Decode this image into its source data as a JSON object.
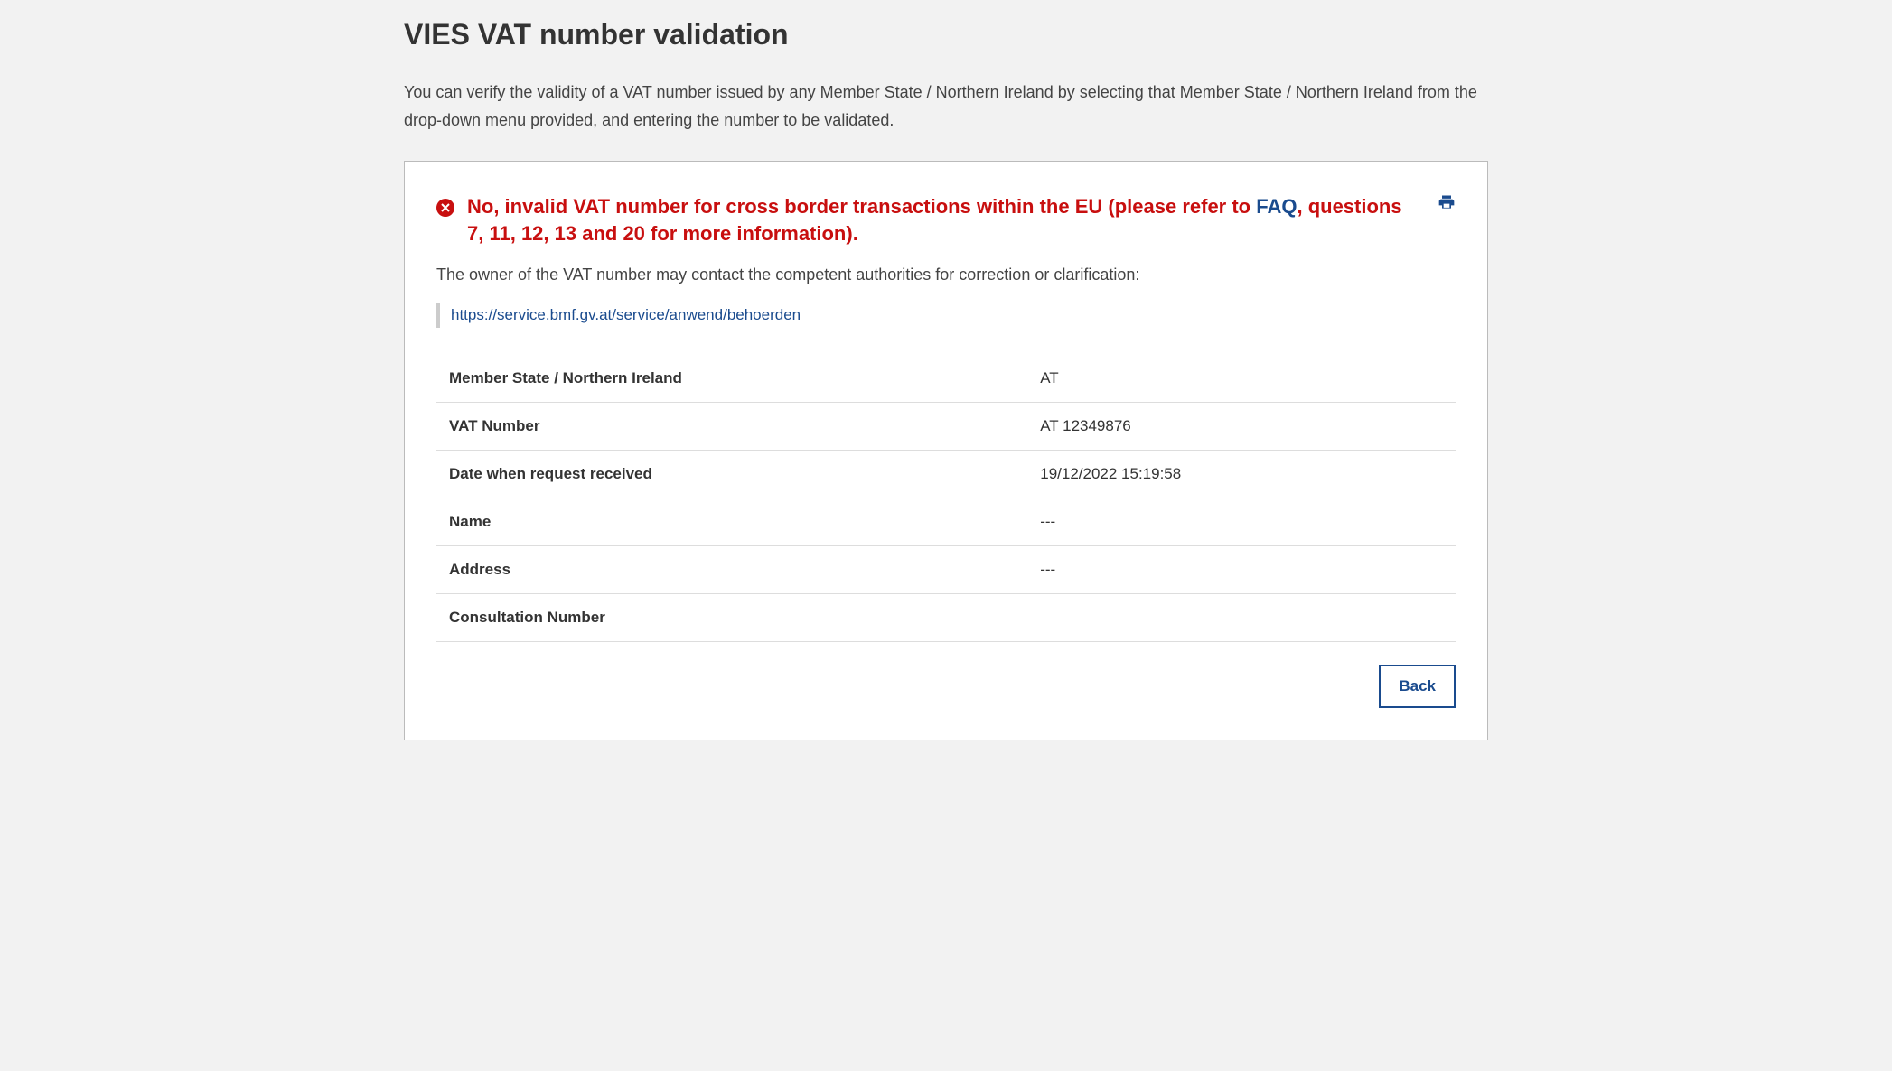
{
  "page": {
    "title": "VIES VAT number validation",
    "intro": "You can verify the validity of a VAT number issued by any Member State / Northern Ireland by selecting that Member State / Northern Ireland from the drop-down menu provided, and entering the number to be validated."
  },
  "alert": {
    "prefix": "No, invalid VAT number for cross border transactions within the EU (please refer to ",
    "faq_text": "FAQ",
    "suffix": ", questions 7, 11, 12, 13 and 20 for more information)."
  },
  "sub_message": "The owner of the VAT number may contact the competent authorities for correction or clarification:",
  "authority_link": "https://service.bmf.gv.at/service/anwend/behoerden",
  "result_rows": [
    {
      "label": "Member State / Northern Ireland",
      "value": "AT"
    },
    {
      "label": "VAT Number",
      "value": "AT 12349876"
    },
    {
      "label": "Date when request received",
      "value": "19/12/2022 15:19:58"
    },
    {
      "label": "Name",
      "value": "---"
    },
    {
      "label": "Address",
      "value": "---"
    },
    {
      "label": "Consultation Number",
      "value": ""
    }
  ],
  "actions": {
    "back": "Back"
  }
}
